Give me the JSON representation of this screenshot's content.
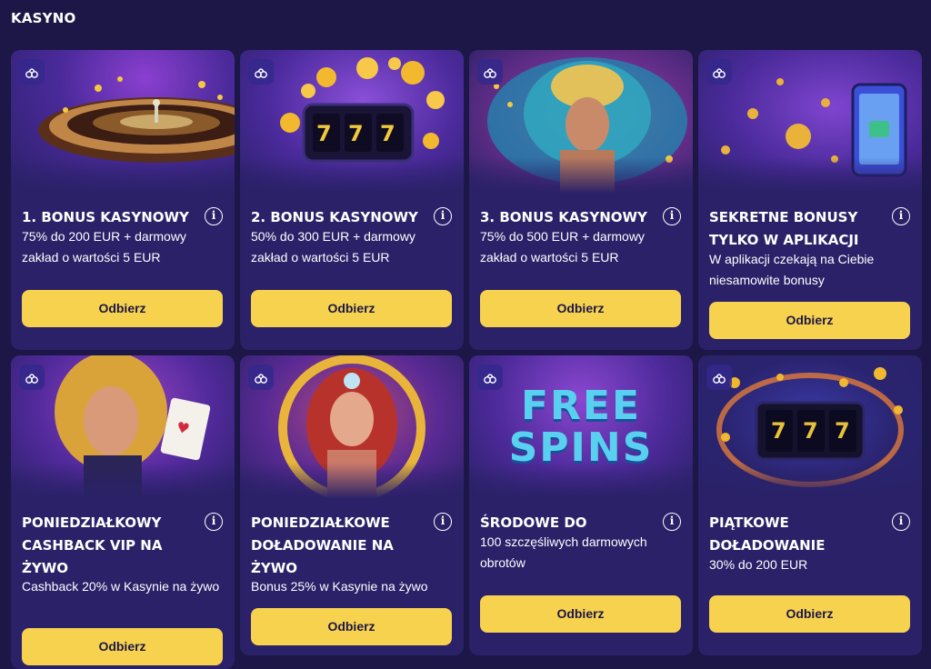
{
  "section": {
    "title": "KASYNO"
  },
  "cards": [
    {
      "title": "1. BONUS KASYNOWY",
      "desc": "75% do 200 EUR + darmowy zakład o wartości 5 EUR",
      "button": "Odbierz"
    },
    {
      "title": "2. BONUS KASYNOWY",
      "desc": "50% do 300 EUR + darmowy zakład o wartości 5 EUR",
      "button": "Odbierz"
    },
    {
      "title": "3. BONUS KASYNOWY",
      "desc": "75% do 500 EUR + darmowy zakład o wartości 5 EUR",
      "button": "Odbierz"
    },
    {
      "title": "SEKRETNE BONUSY TYLKO W APLIKACJI",
      "desc": "W aplikacji czekają na Ciebie niesamowite bonusy",
      "button": "Odbierz"
    },
    {
      "title": "PONIEDZIAŁKOWY CASHBACK VIP NA ŻYWO",
      "desc": "Cashback 20% w Kasynie na żywo",
      "button": "Odbierz"
    },
    {
      "title": "PONIEDZIAŁKOWE DOŁADOWANIE NA ŻYWO",
      "desc": "Bonus 25% w Kasynie na żywo",
      "button": "Odbierz"
    },
    {
      "title": "ŚRODOWE DO",
      "desc": "100 szczęśliwych darmowych obrotów",
      "button": "Odbierz"
    },
    {
      "title": "PIĄTKOWE DOŁADOWANIE",
      "desc": "30% do 200 EUR",
      "button": "Odbierz"
    }
  ],
  "images": {
    "free_spins_line1": "FREE",
    "free_spins_line2": "SPINS",
    "slot_reel_symbol": "7"
  },
  "colors": {
    "background": "#1c1747",
    "card": "#2a2168",
    "button": "#f7d24e",
    "button_text": "#1c1747"
  }
}
